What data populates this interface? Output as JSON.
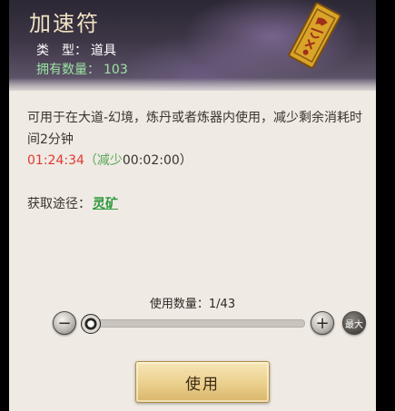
{
  "item": {
    "name": "加速符",
    "type_label": "类　型：",
    "type_value": "道具",
    "count_label": "拥有数量：",
    "count_value": "103",
    "icon": "talisman-scroll-icon"
  },
  "description": "可用于在大道-幻境，炼丹或者炼器内使用，减少剩余消耗时间2分钟",
  "timer": {
    "remaining": "01:24:34",
    "open_paren": "（",
    "reduce_label": "减少",
    "reduce_value": "00:02:00",
    "close_paren": "）"
  },
  "source": {
    "label": "获取途径：",
    "link": "灵矿"
  },
  "quantity": {
    "label": "使用数量：",
    "value": "1/43",
    "current": 1,
    "max": 43
  },
  "buttons": {
    "minus": "−",
    "plus": "+",
    "max": "最大",
    "use": "使用"
  },
  "colors": {
    "accent_red": "#e03a2f",
    "accent_green": "#2e9a3e",
    "header_bg": "#3d3646",
    "panel_bg": "#efeae3"
  }
}
